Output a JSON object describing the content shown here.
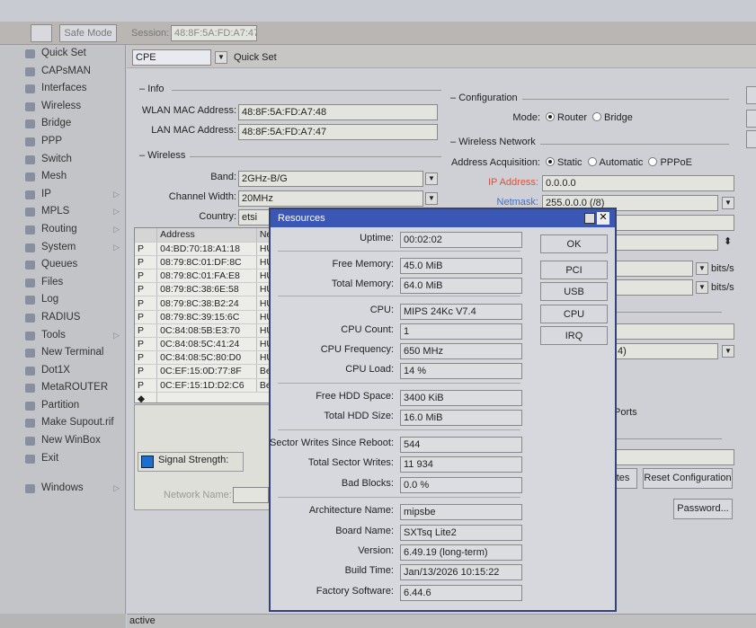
{
  "toolbar": {
    "safe_mode": "Safe Mode",
    "session_label": "Session:",
    "session_value": "48:8F:5A:FD:A7:47"
  },
  "sidebar": {
    "items": [
      {
        "label": "Quick Set",
        "sub": false
      },
      {
        "label": "CAPsMAN",
        "sub": false
      },
      {
        "label": "Interfaces",
        "sub": false
      },
      {
        "label": "Wireless",
        "sub": false
      },
      {
        "label": "Bridge",
        "sub": false
      },
      {
        "label": "PPP",
        "sub": false
      },
      {
        "label": "Switch",
        "sub": false
      },
      {
        "label": "Mesh",
        "sub": false
      },
      {
        "label": "IP",
        "sub": true
      },
      {
        "label": "MPLS",
        "sub": true
      },
      {
        "label": "Routing",
        "sub": true
      },
      {
        "label": "System",
        "sub": true
      },
      {
        "label": "Queues",
        "sub": false
      },
      {
        "label": "Files",
        "sub": false
      },
      {
        "label": "Log",
        "sub": false
      },
      {
        "label": "RADIUS",
        "sub": false
      },
      {
        "label": "Tools",
        "sub": true
      },
      {
        "label": "New Terminal",
        "sub": false
      },
      {
        "label": "Dot1X",
        "sub": false
      },
      {
        "label": "MetaROUTER",
        "sub": false
      },
      {
        "label": "Partition",
        "sub": false
      },
      {
        "label": "Make Supout.rif",
        "sub": false
      },
      {
        "label": "New WinBox",
        "sub": false
      },
      {
        "label": "Exit",
        "sub": false
      }
    ],
    "windows": "Windows"
  },
  "quickset": {
    "mode_select": "CPE",
    "title": "Quick Set",
    "info_legend": "Info",
    "wlan_mac_label": "WLAN MAC Address:",
    "wlan_mac": "48:8F:5A:FD:A7:48",
    "lan_mac_label": "LAN MAC Address:",
    "lan_mac": "48:8F:5A:FD:A7:47",
    "wireless_legend": "Wireless",
    "band_label": "Band:",
    "band": "2GHz-B/G",
    "channel_width_label": "Channel Width:",
    "channel_width": "20MHz",
    "country_label": "Country:",
    "country": "etsi",
    "scan_columns": [
      "Address",
      "Ne"
    ],
    "scan_rows": [
      [
        "P",
        "04:BD:70:18:A1:18",
        "HU"
      ],
      [
        "P",
        "08:79:8C:01:DF:8C",
        "HU"
      ],
      [
        "P",
        "08:79:8C:01:FA:E8",
        "HU"
      ],
      [
        "P",
        "08:79:8C:38:6E:58",
        "HU"
      ],
      [
        "P",
        "08:79:8C:38:B2:24",
        "HU"
      ],
      [
        "P",
        "08:79:8C:39:15:6C",
        "HU"
      ],
      [
        "P",
        "0C:84:08:5B:E3:70",
        "HU"
      ],
      [
        "P",
        "0C:84:08:5C:41:24",
        "HU"
      ],
      [
        "P",
        "0C:84:08:5C:80:D0",
        "HU"
      ],
      [
        "P",
        "0C:EF:15:0D:77:8F",
        "Be"
      ],
      [
        "P",
        "0C:EF:15:1D:D2:C6",
        "Be"
      ]
    ],
    "signal_strength": "Signal Strength:",
    "network_name_label": "Network Name:",
    "config_legend": "Configuration",
    "mode_label": "Mode:",
    "mode_router": "Router",
    "mode_bridge": "Bridge",
    "wnet_legend": "Wireless Network",
    "addr_acq_label": "Address Acquisition:",
    "acq_static": "Static",
    "acq_auto": "Automatic",
    "acq_pppoe": "PPPoE",
    "ip_label": "IP Address:",
    "ip": "0.0.0.0",
    "netmask_label": "Netmask:",
    "netmask": "255.0.0.0 (/8)",
    "bits1": "bits/s",
    "bits2": "bits/s",
    "partial_select": "4)",
    "ports": "Ports",
    "check_updates": "ates",
    "reset_config": "Reset Configuration",
    "password": "Password..."
  },
  "status": "active",
  "resources": {
    "title": "Resources",
    "rows": [
      {
        "label": "Uptime:",
        "value": "00:02:02"
      },
      {
        "label": "Free Memory:",
        "value": "45.0 MiB"
      },
      {
        "label": "Total Memory:",
        "value": "64.0 MiB"
      },
      {
        "label": "CPU:",
        "value": "MIPS 24Kc V7.4"
      },
      {
        "label": "CPU Count:",
        "value": "1"
      },
      {
        "label": "CPU Frequency:",
        "value": "650 MHz"
      },
      {
        "label": "CPU Load:",
        "value": "14 %"
      },
      {
        "label": "Free HDD Space:",
        "value": "3400 KiB"
      },
      {
        "label": "Total HDD Size:",
        "value": "16.0 MiB"
      },
      {
        "label": "Sector Writes Since Reboot:",
        "value": "544"
      },
      {
        "label": "Total Sector Writes:",
        "value": "11 934"
      },
      {
        "label": "Bad Blocks:",
        "value": "0.0 %"
      },
      {
        "label": "Architecture Name:",
        "value": "mipsbe"
      },
      {
        "label": "Board Name:",
        "value": "SXTsq Lite2"
      },
      {
        "label": "Version:",
        "value": "6.49.19 (long-term)"
      },
      {
        "label": "Build Time:",
        "value": "Jan/13/2026 10:15:22"
      },
      {
        "label": "Factory Software:",
        "value": "6.44.6"
      }
    ],
    "buttons": [
      "OK",
      "PCI",
      "USB",
      "CPU",
      "IRQ"
    ]
  }
}
